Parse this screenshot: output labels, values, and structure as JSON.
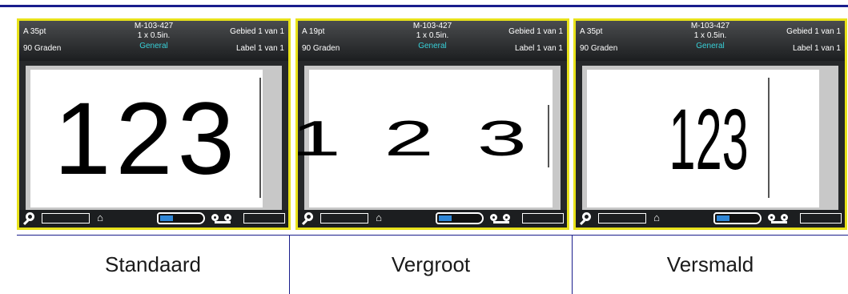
{
  "screens": [
    {
      "header": {
        "font_size": "A 35pt",
        "rotation": "90 Graden",
        "part_number": "M-103-427",
        "size": "1 x 0.5in.",
        "material": "General",
        "area": "Gebied 1 van 1",
        "label": "Label 1 van 1"
      },
      "label_text": "123",
      "caption": "Standaard"
    },
    {
      "header": {
        "font_size": "A 19pt",
        "rotation": "90 Graden",
        "part_number": "M-103-427",
        "size": "1 x 0.5in.",
        "material": "General",
        "area": "Gebied 1 van 1",
        "label": "Label 1 van 1"
      },
      "label_text": "123",
      "caption": "Vergroot"
    },
    {
      "header": {
        "font_size": "A 35pt",
        "rotation": "90 Graden",
        "part_number": "M-103-427",
        "size": "1 x 0.5in.",
        "material": "General",
        "area": "Gebied 1 van 1",
        "label": "Label 1 van 1"
      },
      "label_text": "123",
      "caption": "Versmald"
    }
  ],
  "icons": {
    "zoom": "magnifier-icon",
    "lock": "house-lock-icon",
    "battery": "battery-icon",
    "tape": "tape-reel-icon"
  },
  "colors": {
    "accent_rule": "#1a1d8c",
    "screen_border": "#e8e21a",
    "material_text": "#38d0d8",
    "battery_fill": "#2f86d6"
  }
}
